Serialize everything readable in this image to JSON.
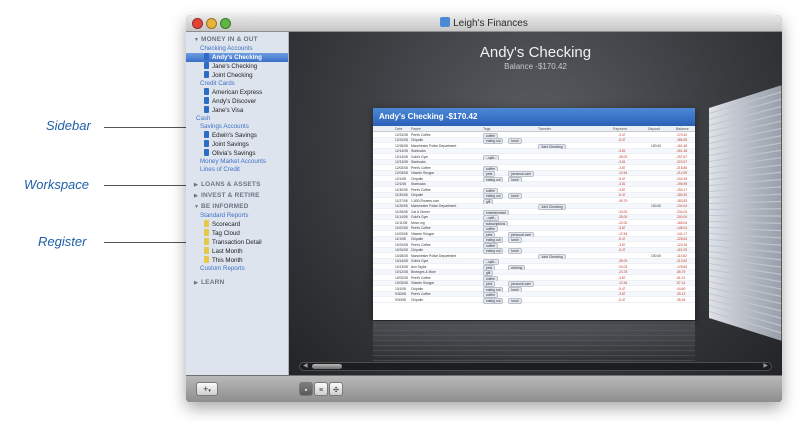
{
  "window": {
    "title": "Leigh's Finances"
  },
  "callouts": {
    "sidebar": "Sidebar",
    "workspace": "Workspace",
    "register": "Register"
  },
  "sidebar": {
    "money_header": "MONEY IN & OUT",
    "checking_accounts": "Checking Accounts",
    "checking": [
      "Andy's Checking",
      "Jane's Checking",
      "Joint Checking"
    ],
    "credit_cards": "Credit Cards",
    "cards": [
      "American Express",
      "Andy's Discover",
      "Jane's Visa"
    ],
    "cash": "Cash",
    "savings_accounts": "Savings Accounts",
    "savings": [
      "Edwin's Savings",
      "Joint Savings",
      "Olivia's Savings"
    ],
    "money_market": "Money Market Accounts",
    "lines_of_credit": "Lines of Credit",
    "loans_header": "LOANS & ASSETS",
    "invest_header": "INVEST & RETIRE",
    "informed_header": "BE INFORMED",
    "standard_reports": "Standard Reports",
    "reports": [
      "Scorecard",
      "Tag Cloud",
      "Transaction Detail",
      "Last Month",
      "This Month"
    ],
    "custom_reports": "Custom Reports",
    "learn_header": "LEARN"
  },
  "workspace": {
    "title": "Andy's Checking",
    "balance": "Balance -$170.42"
  },
  "register": {
    "header": "Andy's Checking -$170.42",
    "columns": {
      "date": "Date",
      "payee": "Payee",
      "tags": "Tags",
      "transfer": "Transfer",
      "payment": "Payment",
      "deposit": "Deposit",
      "balance": "Balance"
    },
    "rows": [
      {
        "date": "12/31/08",
        "payee": "Peet's Coffee",
        "tag": "coffee",
        "tag2": "",
        "transfer": "",
        "payment": "-3.47",
        "deposit": "",
        "balance": "-170.42"
      },
      {
        "date": "12/31/08",
        "payee": "Chipotle",
        "tag": "eating out",
        "tag2": "lunch",
        "transfer": "",
        "payment": "-5.47",
        "deposit": "",
        "balance": "-166.95"
      },
      {
        "date": "12/26/08",
        "payee": "Manchester Police Department",
        "tag": "",
        "tag2": "",
        "transfer": "Joint Checking",
        "payment": "",
        "deposit": "100.00",
        "balance": "-161.48"
      },
      {
        "date": "12/14/08",
        "payee": "Starbucks",
        "tag": "",
        "tag2": "",
        "transfer": "",
        "payment": "-3.81",
        "deposit": "",
        "balance": "-261.48"
      },
      {
        "date": "12/14/08",
        "payee": "Gold's Gym",
        "tag": "--split--",
        "tag2": "",
        "transfer": "",
        "payment": "-35.00",
        "deposit": "",
        "balance": "-257.67"
      },
      {
        "date": "12/13/08",
        "payee": "Starbucks",
        "tag": "",
        "tag2": "",
        "transfer": "",
        "payment": "-3.81",
        "deposit": "",
        "balance": "-222.67"
      },
      {
        "date": "12/02/08",
        "payee": "Peet's Coffee",
        "tag": "coffee",
        "tag2": "",
        "transfer": "",
        "payment": "-3.87",
        "deposit": "",
        "balance": "-218.86"
      },
      {
        "date": "12/03/08",
        "payee": "Vitamin Shoppe",
        "tag": "pets",
        "tag2": "personal care",
        "transfer": "",
        "payment": "-12.54",
        "deposit": "",
        "balance": "-214.99"
      },
      {
        "date": "12/1/08",
        "payee": "Chipotle",
        "tag": "eating out",
        "tag2": "lunch",
        "transfer": "",
        "payment": "-5.47",
        "deposit": "",
        "balance": "-202.45"
      },
      {
        "date": "12/1/08",
        "payee": "Starbucks",
        "tag": "",
        "tag2": "",
        "transfer": "",
        "payment": "-3.81",
        "deposit": "",
        "balance": "-196.98"
      },
      {
        "date": "11/30/08",
        "payee": "Peet's Coffee",
        "tag": "coffee",
        "tag2": "",
        "transfer": "",
        "payment": "-3.87",
        "deposit": "",
        "balance": "-193.17"
      },
      {
        "date": "11/30/08",
        "payee": "Chipotle",
        "tag": "eating out",
        "tag2": "lunch",
        "transfer": "",
        "payment": "-5.47",
        "deposit": "",
        "balance": "-189.30"
      },
      {
        "date": "11/27/08",
        "payee": "1-800-Flowers.com",
        "tag": "gift",
        "tag2": "",
        "transfer": "",
        "payment": "-49.79",
        "deposit": "",
        "balance": "-183.83"
      },
      {
        "date": "11/26/08",
        "payee": "Manchester Police Department",
        "tag": "",
        "tag2": "",
        "transfer": "Joint Checking",
        "payment": "",
        "deposit": "100.00",
        "balance": "-134.04"
      },
      {
        "date": "11/26/08",
        "payee": "Cat & Dinner",
        "tag": "entertainment",
        "tag2": "",
        "transfer": "",
        "payment": "-34.00",
        "deposit": "",
        "balance": "-234.04"
      },
      {
        "date": "11/14/08",
        "payee": "Gold's Gym",
        "tag": "--split--",
        "tag2": "",
        "transfer": "",
        "payment": "-35.00",
        "deposit": "",
        "balance": "-200.04"
      },
      {
        "date": "11/11/08",
        "payee": "Move.org",
        "tag": "subscriptions",
        "tag2": "",
        "transfer": "",
        "payment": "-20.00",
        "deposit": "",
        "balance": "-165.04"
      },
      {
        "date": "11/02/08",
        "payee": "Peet's Coffee",
        "tag": "coffee",
        "tag2": "",
        "transfer": "",
        "payment": "-3.87",
        "deposit": "",
        "balance": "-145.04"
      },
      {
        "date": "11/03/08",
        "payee": "Vitamin Shoppe",
        "tag": "pets",
        "tag2": "personal care",
        "transfer": "",
        "payment": "-12.54",
        "deposit": "",
        "balance": "-141.17"
      },
      {
        "date": "11/1/08",
        "payee": "Chipotle",
        "tag": "eating out",
        "tag2": "lunch",
        "transfer": "",
        "payment": "-5.47",
        "deposit": "",
        "balance": "-128.63"
      },
      {
        "date": "10/31/08",
        "payee": "Peet's Coffee",
        "tag": "coffee",
        "tag2": "",
        "transfer": "",
        "payment": "-3.87",
        "deposit": "",
        "balance": "-123.16"
      },
      {
        "date": "10/31/08",
        "payee": "Chipotle",
        "tag": "eating out",
        "tag2": "lunch",
        "transfer": "",
        "payment": "-5.47",
        "deposit": "",
        "balance": "-119.29"
      },
      {
        "date": "10/26/08",
        "payee": "Manchester Police Department",
        "tag": "",
        "tag2": "",
        "transfer": "Joint Checking",
        "payment": "",
        "deposit": "100.00",
        "balance": "-113.82"
      },
      {
        "date": "10/14/08",
        "payee": "Gold's Gym",
        "tag": "--split--",
        "tag2": "",
        "transfer": "",
        "payment": "-35.00",
        "deposit": "",
        "balance": "-213.82"
      },
      {
        "date": "10/13/08",
        "payee": "Ann Taylor",
        "tag": "pets",
        "tag2": "clothing",
        "transfer": "",
        "payment": "-93.03",
        "deposit": "",
        "balance": "-178.82"
      },
      {
        "date": "10/12/08",
        "payee": "Bevinges & More",
        "tag": "gift",
        "tag2": "",
        "transfer": "",
        "payment": "-24.78",
        "deposit": "",
        "balance": "-85.79"
      },
      {
        "date": "10/02/08",
        "payee": "Peet's Coffee",
        "tag": "coffee",
        "tag2": "",
        "transfer": "",
        "payment": "-3.87",
        "deposit": "",
        "balance": "-61.01"
      },
      {
        "date": "10/03/08",
        "payee": "Vitamin Shoppe",
        "tag": "pets",
        "tag2": "personal care",
        "transfer": "",
        "payment": "-12.54",
        "deposit": "",
        "balance": "-57.14"
      },
      {
        "date": "10/1/08",
        "payee": "Chipotle",
        "tag": "eating out",
        "tag2": "lunch",
        "transfer": "",
        "payment": "-5.47",
        "deposit": "",
        "balance": "-44.60"
      },
      {
        "date": "9/30/08",
        "payee": "Peet's Coffee",
        "tag": "coffee",
        "tag2": "",
        "transfer": "",
        "payment": "-3.87",
        "deposit": "",
        "balance": "-39.13"
      },
      {
        "date": "9/30/08",
        "payee": "Chipotle",
        "tag": "eating out",
        "tag2": "lunch",
        "transfer": "",
        "payment": "-5.47",
        "deposit": "",
        "balance": "-35.26"
      }
    ]
  },
  "bottombar": {
    "add_label": "+",
    "view_icons": [
      "grid-view-icon",
      "list-view-icon",
      "tile-view-icon"
    ]
  },
  "colors": {
    "selection": "#3a70c7",
    "register_header": "#2a61b8",
    "sidebar_bg": "#dde4ee",
    "workspace_bg": "#3a3c40"
  }
}
